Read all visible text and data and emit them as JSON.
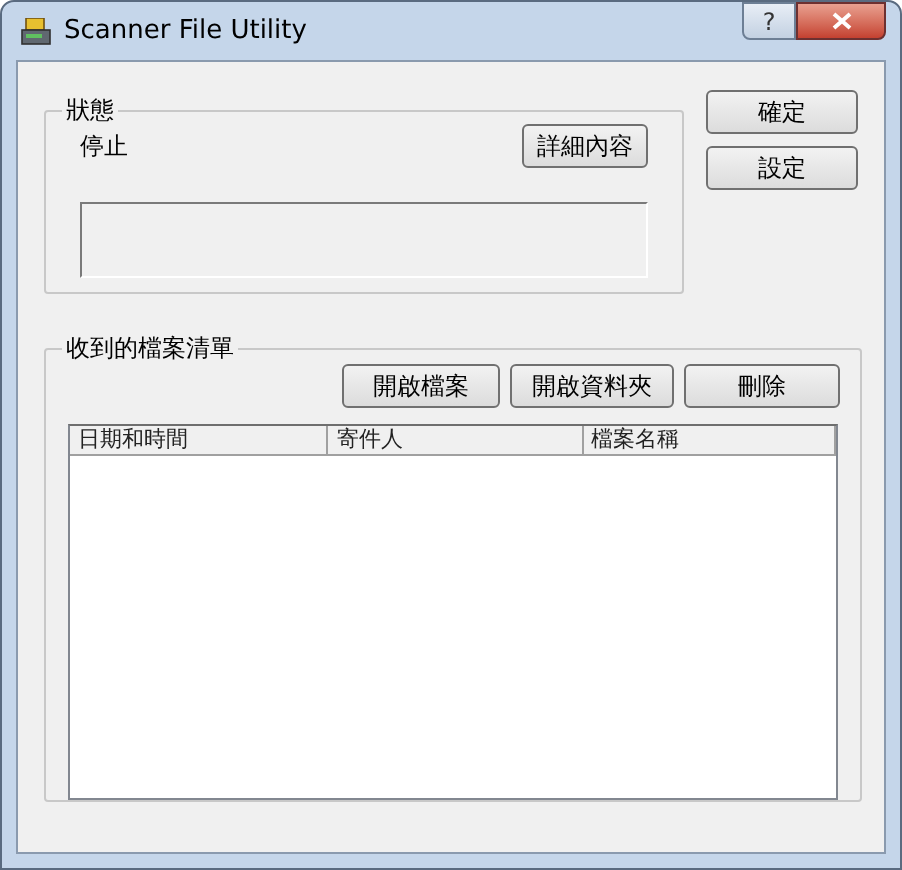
{
  "window": {
    "title": "Scanner File Utility",
    "help_button": "?"
  },
  "status_group": {
    "title": "狀態",
    "state": "停止",
    "details_button": "詳細內容"
  },
  "side_buttons": [
    "確定",
    "設定"
  ],
  "files_group": {
    "title": "收到的檔案清單",
    "buttons": [
      "開啟檔案",
      "開啟資料夾",
      "刪除"
    ],
    "table": {
      "columns": [
        "日期和時間",
        "寄件人",
        "檔案名稱"
      ]
    }
  }
}
